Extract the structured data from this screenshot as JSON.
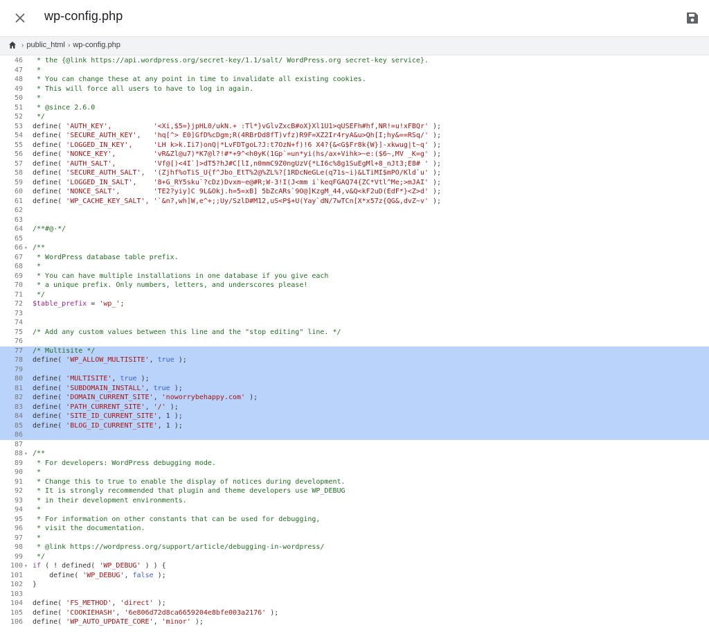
{
  "window": {
    "title": "wp-config.php"
  },
  "breadcrumb": {
    "items": [
      "public_html",
      "wp-config.php"
    ]
  },
  "colors": {
    "selection": "#bad3fb",
    "comment": "#236e24",
    "string": "#a31515",
    "keyword": "#7a3e9d",
    "boolean": "#3a5fcd"
  },
  "editor": {
    "selected_lines": [
      77,
      78,
      79,
      80,
      81,
      82,
      83,
      84,
      85,
      86
    ],
    "fold_lines": [
      66,
      88,
      100
    ],
    "lines": [
      {
        "n": 46,
        "tokens": [
          {
            "t": "c",
            "v": " * the {@link https://api.wordpress.org/secret-key/1.1/salt/ WordPress.org secret-key service}."
          }
        ]
      },
      {
        "n": 47,
        "tokens": [
          {
            "t": "c",
            "v": " *"
          }
        ]
      },
      {
        "n": 48,
        "tokens": [
          {
            "t": "c",
            "v": " * You can change these at any point in time to invalidate all existing cookies."
          }
        ]
      },
      {
        "n": 49,
        "tokens": [
          {
            "t": "c",
            "v": " * This will force all users to have to log in again."
          }
        ]
      },
      {
        "n": 50,
        "tokens": [
          {
            "t": "c",
            "v": " *"
          }
        ]
      },
      {
        "n": 51,
        "tokens": [
          {
            "t": "c",
            "v": " * @since 2.6.0"
          }
        ]
      },
      {
        "n": 52,
        "tokens": [
          {
            "t": "c",
            "v": " */"
          }
        ]
      },
      {
        "n": 53,
        "tokens": [
          {
            "t": "f",
            "v": "define( "
          },
          {
            "t": "s",
            "v": "'AUTH_KEY',"
          },
          {
            "t": "p",
            "v": "          "
          },
          {
            "t": "s",
            "v": "'<Xi,$5=}jpHL0/ukN.+ :Tl*}vGlvZxcB#oX}Xl1U1>qUSEFh#hf,NR!=u!xFBQr'"
          },
          {
            "t": "p",
            "v": " );"
          }
        ]
      },
      {
        "n": 54,
        "tokens": [
          {
            "t": "f",
            "v": "define( "
          },
          {
            "t": "s",
            "v": "'SECURE_AUTH_KEY',"
          },
          {
            "t": "p",
            "v": "   "
          },
          {
            "t": "s",
            "v": "'hq[^> E0]GfD%cDgm;R(4RBrDd8fT)vfz)R9F=XZ2Ir4ryA&u>Qh[I;hy&==RSq/'"
          },
          {
            "t": "p",
            "v": " );"
          }
        ]
      },
      {
        "n": 55,
        "tokens": [
          {
            "t": "f",
            "v": "define( "
          },
          {
            "t": "s",
            "v": "'LOGGED_IN_KEY',"
          },
          {
            "t": "p",
            "v": "     "
          },
          {
            "t": "s",
            "v": "'LH k>k.Ii7)onQ|*LvFDTgoL?J:t7OzN+f)!6 X4?{&<G$Fr8k{W}]-xkwug|t~q'"
          },
          {
            "t": "p",
            "v": " );"
          }
        ]
      },
      {
        "n": 56,
        "tokens": [
          {
            "t": "f",
            "v": "define( "
          },
          {
            "t": "s",
            "v": "'NONCE_KEY',"
          },
          {
            "t": "p",
            "v": "         "
          },
          {
            "t": "s",
            "v": "'vR&Zl@u7)*K7@l?!#*+9^<h0yK(1Gp`=un*yi(hs/ax+Vihk>~e:($6~,MV _K=g'"
          },
          {
            "t": "p",
            "v": " );"
          }
        ]
      },
      {
        "n": 57,
        "tokens": [
          {
            "t": "f",
            "v": "define( "
          },
          {
            "t": "s",
            "v": "'AUTH_SALT',"
          },
          {
            "t": "p",
            "v": "         "
          },
          {
            "t": "s",
            "v": "'Vf@[)<4I`]>dT5?hJ#C[lI,n0mmC9Z0ngUzV{*LI6c%8g1SuEgMl+8_nJt3;E8# '"
          },
          {
            "t": "p",
            "v": " );"
          }
        ]
      },
      {
        "n": 58,
        "tokens": [
          {
            "t": "f",
            "v": "define( "
          },
          {
            "t": "s",
            "v": "'SECURE_AUTH_SALT',"
          },
          {
            "t": "p",
            "v": "  "
          },
          {
            "t": "s",
            "v": "'(Zjhf%oTiS_U{f^Jbo_EtT%2@%ZL%?[1RDcNeGLe(q71s~i)&LTiMI$mPO/Kld`u'"
          },
          {
            "t": "p",
            "v": " );"
          }
        ]
      },
      {
        "n": 59,
        "tokens": [
          {
            "t": "f",
            "v": "define( "
          },
          {
            "t": "s",
            "v": "'LOGGED_IN_SALT',"
          },
          {
            "t": "p",
            "v": "    "
          },
          {
            "t": "s",
            "v": "'8+G_RY5sku`?cDz)Dvxm~e@#R;W-3!I(J<mm i`keqFGAQ74{ZC*Vtl^Me;>mJAI'"
          },
          {
            "t": "p",
            "v": " );"
          }
        ]
      },
      {
        "n": 60,
        "tokens": [
          {
            "t": "f",
            "v": "define( "
          },
          {
            "t": "s",
            "v": "'NONCE_SALT',"
          },
          {
            "t": "p",
            "v": "        "
          },
          {
            "t": "s",
            "v": "'TE2?yiy]C 9L&Okj.h=5=xB] 5bZcARs`9O@]KzgM_44,v&Q<kF2uD(EdF*}<Z>d'"
          },
          {
            "t": "p",
            "v": " );"
          }
        ]
      },
      {
        "n": 61,
        "tokens": [
          {
            "t": "f",
            "v": "define( "
          },
          {
            "t": "s",
            "v": "'WP_CACHE_KEY_SALT',"
          },
          {
            "t": "p",
            "v": " "
          },
          {
            "t": "s",
            "v": "'`&n?,wh]W,e^+;;Uy/SzlD#M12,uS<P$+U(Yay`dN/7wTCn[X*x57z{QG&,dvZ~v'"
          },
          {
            "t": "p",
            "v": " );"
          }
        ]
      },
      {
        "n": 62,
        "tokens": []
      },
      {
        "n": 63,
        "tokens": []
      },
      {
        "n": 64,
        "tokens": [
          {
            "t": "c",
            "v": "/**#@-*/"
          }
        ]
      },
      {
        "n": 65,
        "tokens": []
      },
      {
        "n": 66,
        "tokens": [
          {
            "t": "c",
            "v": "/**"
          }
        ]
      },
      {
        "n": 67,
        "tokens": [
          {
            "t": "c",
            "v": " * WordPress database table prefix."
          }
        ]
      },
      {
        "n": 68,
        "tokens": [
          {
            "t": "c",
            "v": " *"
          }
        ]
      },
      {
        "n": 69,
        "tokens": [
          {
            "t": "c",
            "v": " * You can have multiple installations in one database if you give each"
          }
        ]
      },
      {
        "n": 70,
        "tokens": [
          {
            "t": "c",
            "v": " * a unique prefix. Only numbers, letters, and underscores please!"
          }
        ]
      },
      {
        "n": 71,
        "tokens": [
          {
            "t": "c",
            "v": " */"
          }
        ]
      },
      {
        "n": 72,
        "tokens": [
          {
            "t": "v",
            "v": "$table_prefix"
          },
          {
            "t": "p",
            "v": " = "
          },
          {
            "t": "s",
            "v": "'wp_'"
          },
          {
            "t": "p",
            "v": ";"
          }
        ]
      },
      {
        "n": 73,
        "tokens": []
      },
      {
        "n": 74,
        "tokens": []
      },
      {
        "n": 75,
        "tokens": [
          {
            "t": "c",
            "v": "/* Add any custom values between this line and the \"stop editing\" line. */"
          }
        ]
      },
      {
        "n": 76,
        "tokens": []
      },
      {
        "n": 77,
        "tokens": [
          {
            "t": "c",
            "v": "/* Multisite */"
          }
        ]
      },
      {
        "n": 78,
        "tokens": [
          {
            "t": "f",
            "v": "define( "
          },
          {
            "t": "s",
            "v": "'WP_ALLOW_MULTISITE'"
          },
          {
            "t": "p",
            "v": ", "
          },
          {
            "t": "b",
            "v": "true"
          },
          {
            "t": "p",
            "v": " );"
          }
        ]
      },
      {
        "n": 79,
        "tokens": []
      },
      {
        "n": 80,
        "tokens": [
          {
            "t": "f",
            "v": "define( "
          },
          {
            "t": "s",
            "v": "'MULTISITE'"
          },
          {
            "t": "p",
            "v": ", "
          },
          {
            "t": "b",
            "v": "true"
          },
          {
            "t": "p",
            "v": " );"
          }
        ]
      },
      {
        "n": 81,
        "tokens": [
          {
            "t": "f",
            "v": "define( "
          },
          {
            "t": "s",
            "v": "'SUBDOMAIN_INSTALL'"
          },
          {
            "t": "p",
            "v": ", "
          },
          {
            "t": "b",
            "v": "true"
          },
          {
            "t": "p",
            "v": " );"
          }
        ]
      },
      {
        "n": 82,
        "tokens": [
          {
            "t": "f",
            "v": "define( "
          },
          {
            "t": "s",
            "v": "'DOMAIN_CURRENT_SITE'"
          },
          {
            "t": "p",
            "v": ", "
          },
          {
            "t": "s",
            "v": "'noworrybehappy.com'"
          },
          {
            "t": "p",
            "v": " );"
          }
        ]
      },
      {
        "n": 83,
        "tokens": [
          {
            "t": "f",
            "v": "define( "
          },
          {
            "t": "s",
            "v": "'PATH_CURRENT_SITE'"
          },
          {
            "t": "p",
            "v": ", "
          },
          {
            "t": "s",
            "v": "'/'"
          },
          {
            "t": "p",
            "v": " );"
          }
        ]
      },
      {
        "n": 84,
        "tokens": [
          {
            "t": "f",
            "v": "define( "
          },
          {
            "t": "s",
            "v": "'SITE_ID_CURRENT_SITE'"
          },
          {
            "t": "p",
            "v": ", 1 );"
          }
        ]
      },
      {
        "n": 85,
        "tokens": [
          {
            "t": "f",
            "v": "define( "
          },
          {
            "t": "s",
            "v": "'BLOG_ID_CURRENT_SITE'"
          },
          {
            "t": "p",
            "v": ", 1 );"
          }
        ]
      },
      {
        "n": 86,
        "tokens": []
      },
      {
        "n": 87,
        "tokens": []
      },
      {
        "n": 88,
        "tokens": [
          {
            "t": "c",
            "v": "/**"
          }
        ]
      },
      {
        "n": 89,
        "tokens": [
          {
            "t": "c",
            "v": " * For developers: WordPress debugging mode."
          }
        ]
      },
      {
        "n": 90,
        "tokens": [
          {
            "t": "c",
            "v": " *"
          }
        ]
      },
      {
        "n": 91,
        "tokens": [
          {
            "t": "c",
            "v": " * Change this to true to enable the display of notices during development."
          }
        ]
      },
      {
        "n": 92,
        "tokens": [
          {
            "t": "c",
            "v": " * It is strongly recommended that plugin and theme developers use WP_DEBUG"
          }
        ]
      },
      {
        "n": 93,
        "tokens": [
          {
            "t": "c",
            "v": " * in their development environments."
          }
        ]
      },
      {
        "n": 94,
        "tokens": [
          {
            "t": "c",
            "v": " *"
          }
        ]
      },
      {
        "n": 95,
        "tokens": [
          {
            "t": "c",
            "v": " * For information on other constants that can be used for debugging,"
          }
        ]
      },
      {
        "n": 96,
        "tokens": [
          {
            "t": "c",
            "v": " * visit the documentation."
          }
        ]
      },
      {
        "n": 97,
        "tokens": [
          {
            "t": "c",
            "v": " *"
          }
        ]
      },
      {
        "n": 98,
        "tokens": [
          {
            "t": "c",
            "v": " * @link https://wordpress.org/support/article/debugging-in-wordpress/"
          }
        ]
      },
      {
        "n": 99,
        "tokens": [
          {
            "t": "c",
            "v": " */"
          }
        ]
      },
      {
        "n": 100,
        "tokens": [
          {
            "t": "k",
            "v": "if"
          },
          {
            "t": "p",
            "v": " ( ! defined( "
          },
          {
            "t": "s",
            "v": "'WP_DEBUG'"
          },
          {
            "t": "p",
            "v": " ) ) {"
          }
        ]
      },
      {
        "n": 101,
        "tokens": [
          {
            "t": "p",
            "v": "    define( "
          },
          {
            "t": "s",
            "v": "'WP_DEBUG'"
          },
          {
            "t": "p",
            "v": ", "
          },
          {
            "t": "b",
            "v": "false"
          },
          {
            "t": "p",
            "v": " );"
          }
        ]
      },
      {
        "n": 102,
        "tokens": [
          {
            "t": "p",
            "v": "}"
          }
        ]
      },
      {
        "n": 103,
        "tokens": []
      },
      {
        "n": 104,
        "tokens": [
          {
            "t": "f",
            "v": "define( "
          },
          {
            "t": "s",
            "v": "'FS_METHOD'"
          },
          {
            "t": "p",
            "v": ", "
          },
          {
            "t": "s",
            "v": "'direct'"
          },
          {
            "t": "p",
            "v": " );"
          }
        ]
      },
      {
        "n": 105,
        "tokens": [
          {
            "t": "f",
            "v": "define( "
          },
          {
            "t": "s",
            "v": "'COOKIEHASH'"
          },
          {
            "t": "p",
            "v": ", "
          },
          {
            "t": "s",
            "v": "'6e806d72d8ca6659204e8bfe003a2176'"
          },
          {
            "t": "p",
            "v": " );"
          }
        ]
      },
      {
        "n": 106,
        "tokens": [
          {
            "t": "f",
            "v": "define( "
          },
          {
            "t": "s",
            "v": "'WP_AUTO_UPDATE_CORE'"
          },
          {
            "t": "p",
            "v": ", "
          },
          {
            "t": "s",
            "v": "'minor'"
          },
          {
            "t": "p",
            "v": " );"
          }
        ]
      }
    ]
  }
}
